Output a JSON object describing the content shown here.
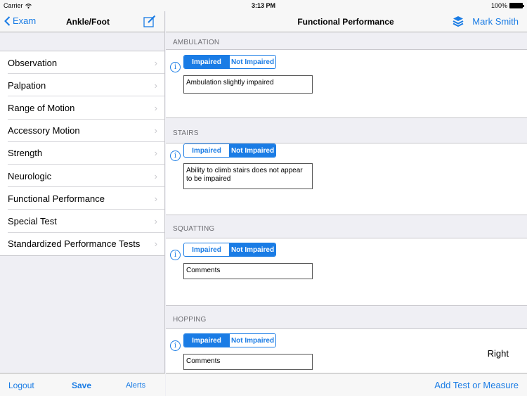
{
  "status_bar": {
    "carrier": "Carrier",
    "time": "3:13 PM",
    "battery": "100%"
  },
  "left_nav": {
    "back_label": "Exam",
    "title": "Ankle/Foot"
  },
  "menu": [
    {
      "label": "Observation"
    },
    {
      "label": "Palpation"
    },
    {
      "label": "Range of Motion"
    },
    {
      "label": "Accessory Motion"
    },
    {
      "label": "Strength"
    },
    {
      "label": "Neurologic"
    },
    {
      "label": "Functional Performance"
    },
    {
      "label": "Special Test"
    },
    {
      "label": "Standardized Performance Tests"
    }
  ],
  "left_toolbar": {
    "logout": "Logout",
    "save": "Save",
    "alerts": "Alerts"
  },
  "right_nav": {
    "title": "Functional Performance",
    "user": "Mark Smith"
  },
  "segment_labels": {
    "impaired": "Impaired",
    "not_impaired": "Not Impaired"
  },
  "sections": [
    {
      "header": "AMBULATION",
      "selected": "Impaired",
      "comment": "Ambulation slightly impaired",
      "side": ""
    },
    {
      "header": "STAIRS",
      "selected": "Not Impaired",
      "comment": "Ability to climb stairs does not appear to be impaired",
      "side": ""
    },
    {
      "header": "SQUATTING",
      "selected": "Not Impaired",
      "comment": "Comments",
      "side": ""
    },
    {
      "header": "HOPPING",
      "selected": "Impaired",
      "comment": "Comments",
      "side": "Right"
    }
  ],
  "right_toolbar": {
    "add": "Add Test or Measure"
  },
  "colors": {
    "accent": "#1a7ce5",
    "background": "#efeff4"
  }
}
